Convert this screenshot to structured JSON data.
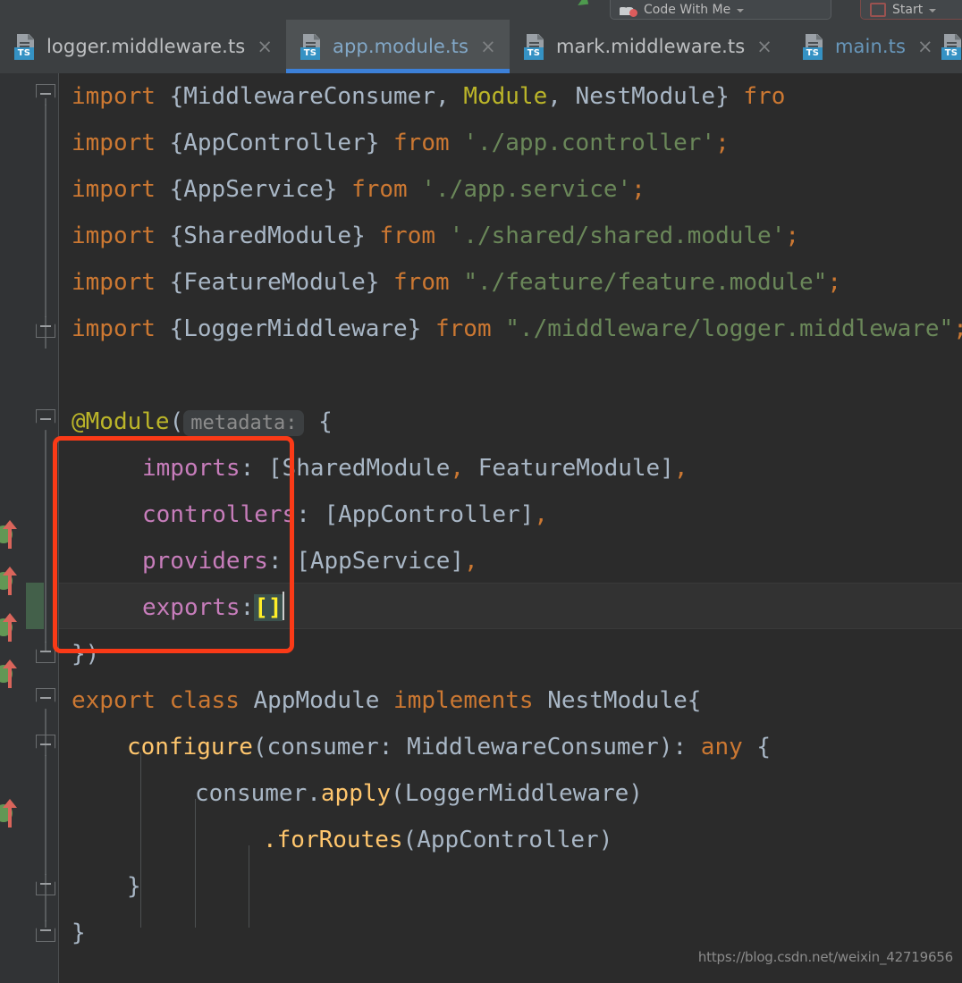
{
  "toolbar": {
    "code_with_me_label": "Code With Me",
    "start_label": "Start",
    "run_icon": "run-arrow-icon",
    "cwm_icon": "code-with-me-icon",
    "start_icon": "stop-square-icon",
    "dropdown_icon": "chevron-down-icon"
  },
  "tabs": [
    {
      "label": "logger.middleware.ts",
      "icon": "typescript-file-icon",
      "badge": "TS",
      "active": false,
      "modified": false,
      "close_icon": "×"
    },
    {
      "label": "app.module.ts",
      "icon": "typescript-file-icon",
      "badge": "TS",
      "active": true,
      "modified": false,
      "close_icon": "×"
    },
    {
      "label": "mark.middleware.ts",
      "icon": "typescript-file-icon",
      "badge": "TS",
      "active": false,
      "modified": false,
      "close_icon": "×"
    },
    {
      "label": "main.ts",
      "icon": "typescript-file-icon",
      "badge": "TS",
      "active": false,
      "modified": true,
      "close_icon": "×"
    },
    {
      "label": "",
      "icon": "typescript-file-icon",
      "badge": "TS",
      "active": false,
      "modified": false,
      "close_icon": ""
    }
  ],
  "editor": {
    "file": "app.module.ts",
    "inline_hint": "metadata:",
    "cursor_line": 12,
    "code_lines": [
      "import {MiddlewareConsumer, Module, NestModule} from '@nestjs/common';",
      "import {AppController} from './app.controller';",
      "import {AppService} from './app.service';",
      "import {SharedModule} from './shared/shared.module';",
      "import {FeatureModule} from \"./feature/feature.module\";",
      "import {LoggerMiddleware} from \"./middleware/logger.middleware\";",
      "",
      "@Module({",
      "    imports: [SharedModule, FeatureModule],",
      "    controllers: [AppController],",
      "    providers: [AppService],",
      "    exports:[]",
      "})",
      "export class AppModule implements NestModule{",
      "    configure(consumer: MiddlewareConsumer): any {",
      "        consumer.apply(LoggerMiddleware)",
      "            .forRoutes(AppController)",
      "    }",
      "}"
    ],
    "tokens": {
      "line1": [
        "import ",
        "{MiddlewareConsumer, ",
        "Module",
        ", NestModule} ",
        "fro"
      ],
      "line2": [
        "import ",
        "{AppController} ",
        "from ",
        "'./app.controller'",
        ";"
      ],
      "line3": [
        "import ",
        "{AppService} ",
        "from ",
        "'./app.service'",
        ";"
      ],
      "line4": [
        "import ",
        "{SharedModule} ",
        "from ",
        "'./shared/shared.module'"
      ],
      "line5": [
        "import ",
        "{FeatureModule} ",
        "from ",
        "\"./feature/feature.modu"
      ],
      "line6": [
        "import ",
        "{LoggerMiddleware} ",
        "from ",
        "\"./middleware/logger"
      ],
      "line8_at": "@Module",
      "line8_open": "(",
      "line8_brace": "{",
      "line9_key": "imports",
      "line9_val": ": [SharedModule",
      "line9_c1": ",",
      "line9_val2": " FeatureModule]",
      "line9_c2": ",",
      "line10_key": "controllers",
      "line10_val": ": [AppController]",
      "line10_c": ",",
      "line11_key": "providers",
      "line11_val": ": [AppService]",
      "line11_c": ",",
      "line12_key": "exports",
      "line12_colon": ":",
      "line12_brk": "[]",
      "line13": "})",
      "line14_kw1": "export ",
      "line14_kw2": "class ",
      "line14_id1": "AppModule ",
      "line14_kw3": "implements ",
      "line14_id2": "NestModule{",
      "line15_fn": "configure",
      "line15_rest": "(consumer: MiddlewareConsumer): ",
      "line15_any": "any",
      "line15_brace": " {",
      "line16_obj": "consumer.",
      "line16_fn": "apply",
      "line16_rest": "(LoggerMiddleware)",
      "line17_dot": ".",
      "line17_fn": "forRoutes",
      "line17_rest": "(AppController)",
      "line18": "}",
      "line19": "}"
    }
  },
  "annotation": {
    "type": "red-rectangle",
    "color": "#FA3A17",
    "covers": "module-metadata-object-keys"
  },
  "watermark": {
    "text": "https://blog.csdn.net/weixin_42719656"
  },
  "colors": {
    "editor_bg": "#2B2B2B",
    "gutter_bg": "#313335",
    "chrome_bg": "#3C3F41",
    "active_tab_bg": "#4E5254",
    "tab_underline": "#3C80D8",
    "keyword": "#CC7832",
    "string": "#6A8759",
    "identifier": "#A9B7C6",
    "annotation": "#BBB529",
    "property": "#C77DBB",
    "function": "#FFC66D",
    "number": "#6897BB",
    "bracket_highlight_bg": "#3B514D",
    "bracket_highlight_fg": "#FFEF28"
  }
}
